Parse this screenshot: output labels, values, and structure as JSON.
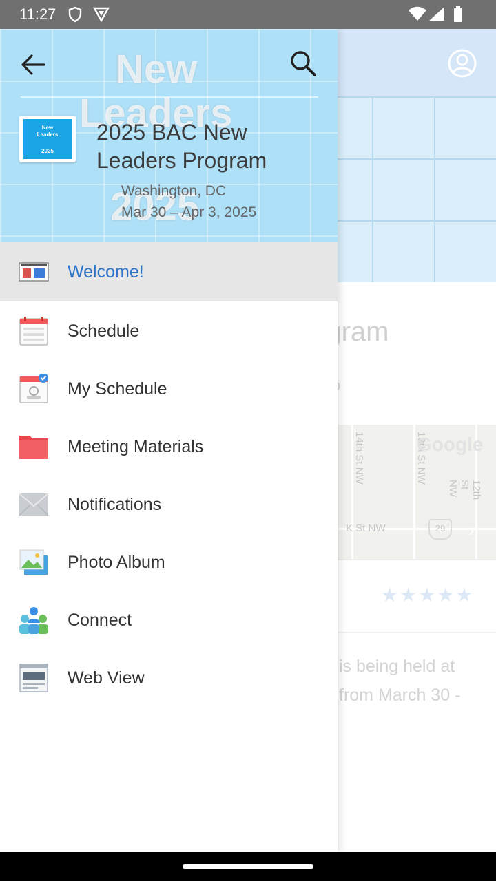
{
  "status_bar": {
    "time": "11:27"
  },
  "drawer": {
    "header": {
      "watermark": [
        "New",
        "Leaders",
        "2025"
      ],
      "logo_text": [
        "New",
        "Leaders",
        "2025"
      ],
      "title": "2025 BAC New Leaders Program",
      "location": "Washington, DC",
      "dates": "Mar 30 – Apr 3, 2025"
    },
    "menu": [
      {
        "label": "Welcome!",
        "icon": "welcome-icon",
        "active": true
      },
      {
        "label": "Schedule",
        "icon": "calendar-icon"
      },
      {
        "label": "My Schedule",
        "icon": "my-schedule-icon"
      },
      {
        "label": "Meeting Materials",
        "icon": "folder-icon"
      },
      {
        "label": "Notifications",
        "icon": "envelope-icon"
      },
      {
        "label": "Photo Album",
        "icon": "photo-icon"
      },
      {
        "label": "Connect",
        "icon": "people-icon"
      },
      {
        "label": "Web View",
        "icon": "web-view-icon"
      }
    ]
  },
  "background": {
    "title_fragment": "s Program",
    "map": {
      "google": "Google",
      "streets": [
        "14th St NW",
        "13th St NW",
        "12th St NW",
        "11th St NW",
        "K St NW"
      ],
      "route": "29"
    },
    "desc_lines": [
      "is being held at",
      "from March 30 -"
    ]
  },
  "colors": {
    "accent": "#2d74c9",
    "header_bg": "#aee0f8"
  }
}
